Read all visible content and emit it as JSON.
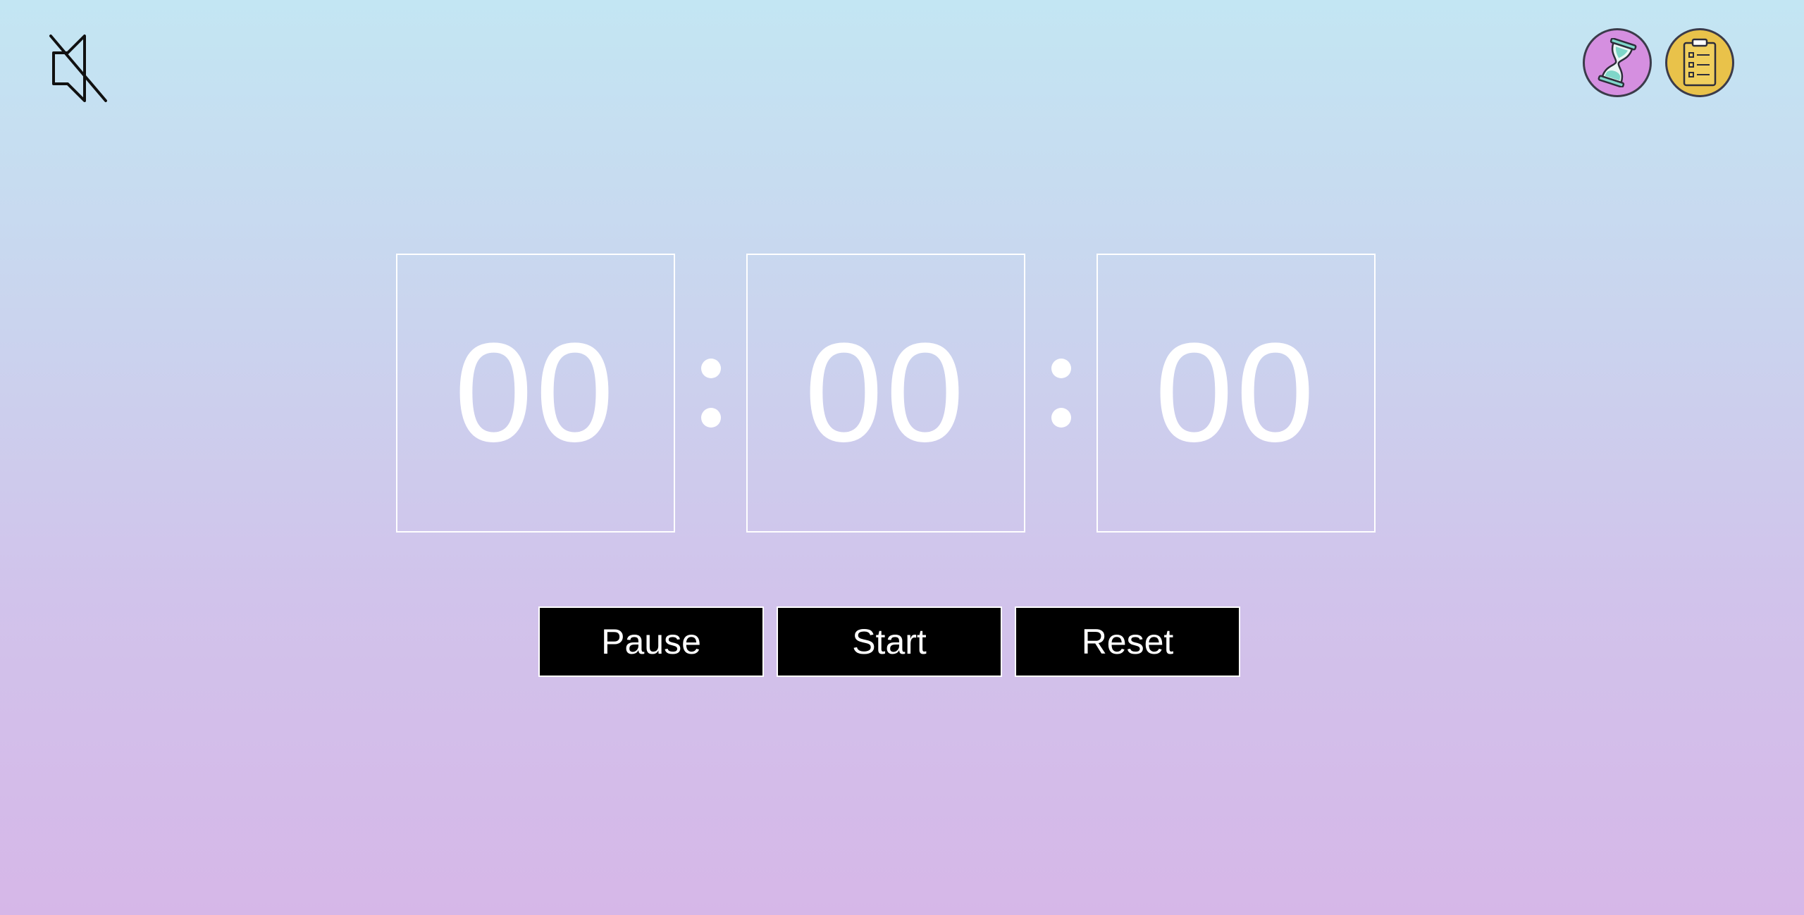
{
  "app": {
    "accent_timer_mode": "#d58fe0",
    "accent_tasks": "#e9c24a"
  },
  "icons": {
    "mute": "speaker-muted-icon",
    "timer_mode": "hourglass-icon",
    "tasks": "clipboard-checklist-icon"
  },
  "clock": {
    "hours": "00",
    "minutes": "00",
    "seconds": "00"
  },
  "controls": {
    "pause_label": "Pause",
    "start_label": "Start",
    "reset_label": "Reset"
  }
}
